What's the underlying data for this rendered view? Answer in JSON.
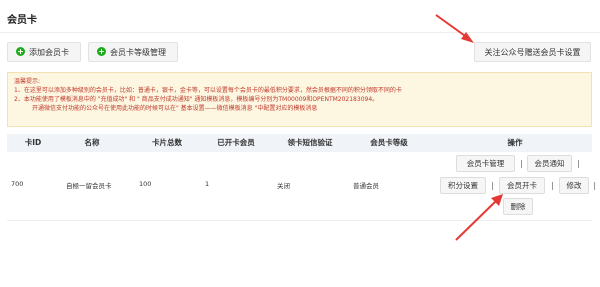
{
  "page": {
    "title": "会员卡"
  },
  "toolbar": {
    "add_label": "添加会员卡",
    "level_label": "会员卡等级管理",
    "follow_label": "关注公众号赠送会员卡设置"
  },
  "notice": {
    "title": "温馨提示:",
    "lines": [
      "1、在这里可以添加多种级别的会员卡，比如：普通卡，银卡，金卡等，可以设置每个会员卡的最低积分要求，然会员根据不同的积分领取不同的卡",
      "2、本功能使用了模板消息中的 \"充值成功\" 和 \" 商品支付成功通知\" 通知模板消息，模板编号分别为TM00009和OPENTM202183094。",
      "开通微信支付功能的公众号在使用此功能的时候可以在\" 基本设置——微信模板消息 \"中配置对应的模板消息"
    ]
  },
  "table": {
    "headers": [
      "卡ID",
      "名称",
      "卡片总数",
      "已开卡会员",
      "领卡短信验证",
      "会员卡等级",
      "操作"
    ],
    "row": {
      "id": "700",
      "name": "自極一留会员卡",
      "total": "100",
      "opened": "1",
      "sms": "关闭",
      "level": "普通会员"
    },
    "actions": {
      "manage": "会员卡管理",
      "notify": "会员通知",
      "points": "积分设置",
      "open": "会员开卡",
      "edit": "修改",
      "delete": "删除",
      "sep": "|"
    }
  },
  "colors": {
    "arrow": "#e53935",
    "plus": "#1aad19",
    "notice_text": "#c0392b"
  }
}
